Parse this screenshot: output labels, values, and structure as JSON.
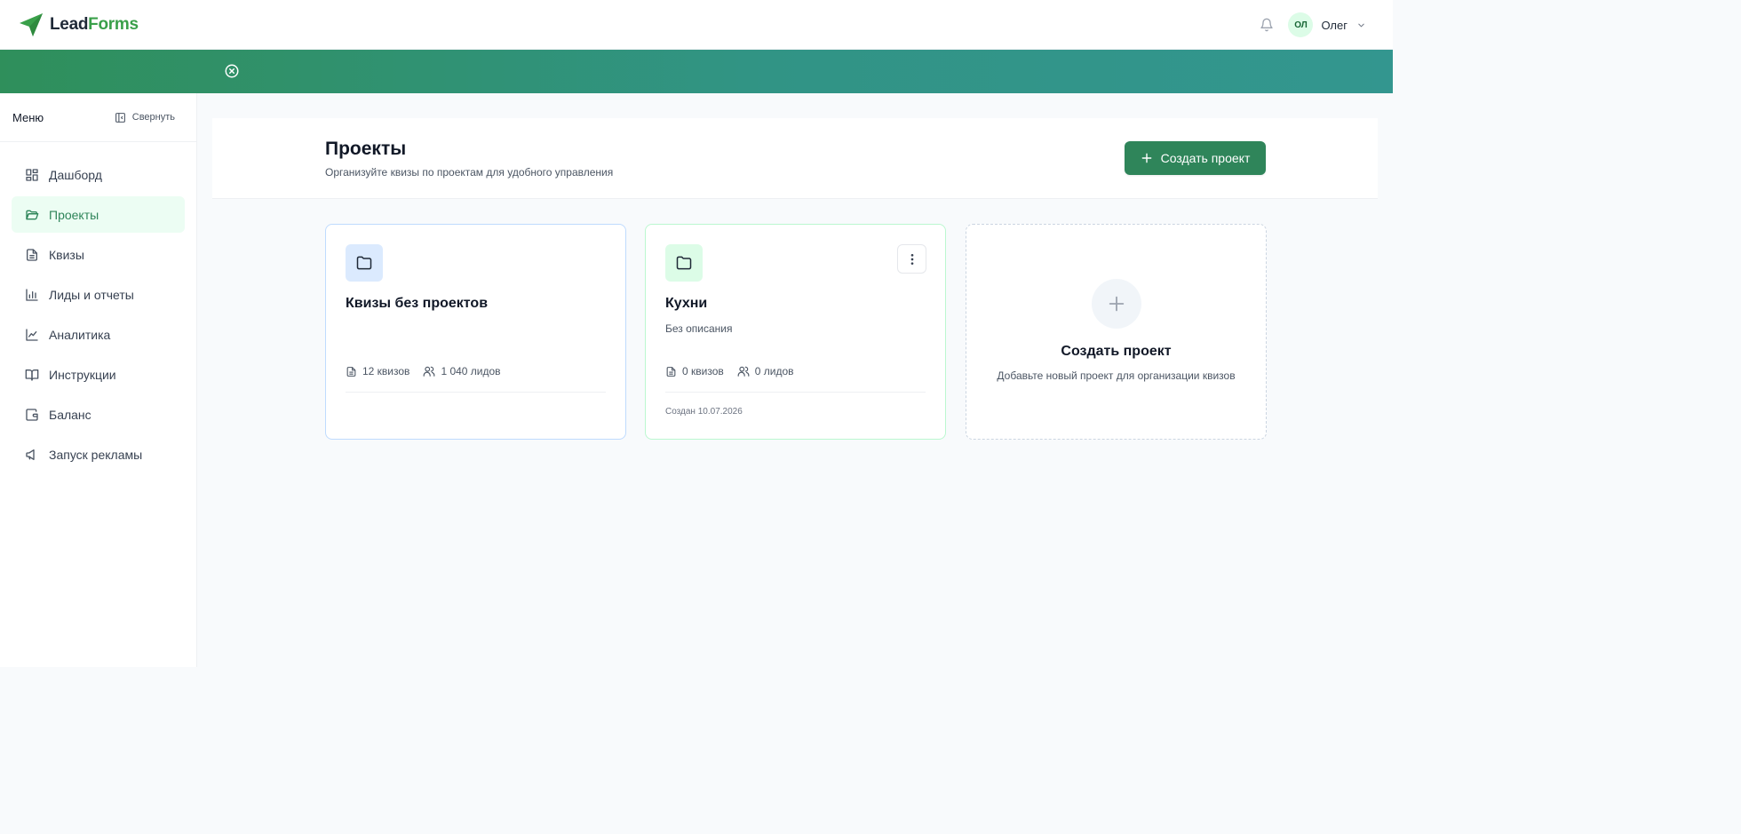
{
  "header": {
    "logo_lead": "Lead",
    "logo_forms": "Forms",
    "avatar_initials": "ОЛ",
    "user_name": "Олег"
  },
  "sidebar": {
    "title": "Меню",
    "collapse_label": "Свернуть",
    "items": [
      {
        "label": "Дашборд",
        "icon": "dashboard-icon"
      },
      {
        "label": "Проекты",
        "icon": "folder-icon",
        "active": true
      },
      {
        "label": "Квизы",
        "icon": "document-icon"
      },
      {
        "label": "Лиды и отчеты",
        "icon": "bar-chart-icon"
      },
      {
        "label": "Аналитика",
        "icon": "line-chart-icon"
      },
      {
        "label": "Инструкции",
        "icon": "book-icon"
      },
      {
        "label": "Баланс",
        "icon": "wallet-icon"
      },
      {
        "label": "Запуск рекламы",
        "icon": "megaphone-icon"
      }
    ]
  },
  "page": {
    "title": "Проекты",
    "subtitle": "Организуйте квизы по проектам для удобного управления",
    "create_button": "Создать проект"
  },
  "cards": [
    {
      "title": "Квизы без проектов",
      "description": "",
      "quizzes": "12 квизов",
      "leads": "1 040 лидов",
      "created": ""
    },
    {
      "title": "Кухни",
      "description": "Без описания",
      "quizzes": "0 квизов",
      "leads": "0 лидов",
      "created": "Создан 10.07.2026"
    }
  ],
  "add_card": {
    "title": "Создать проект",
    "description": "Добавьте новый проект для организации квизов"
  },
  "colors": {
    "accent": "#2f855a",
    "logo_green": "#3aa04a",
    "banner_start": "#2f8f5b",
    "banner_end": "#33968f"
  }
}
